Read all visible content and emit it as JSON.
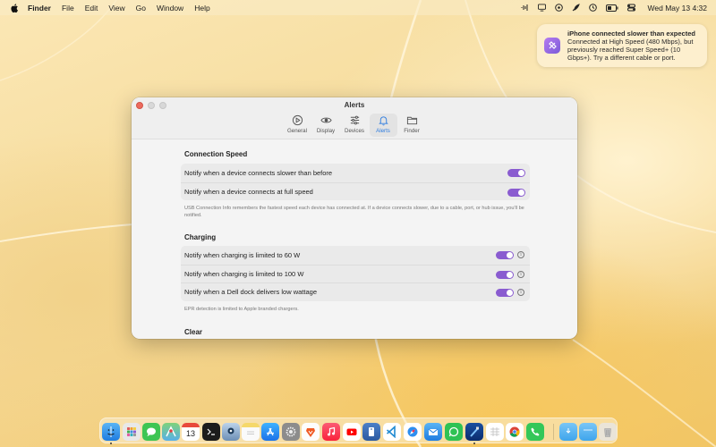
{
  "menubar": {
    "app_name": "Finder",
    "menus": [
      "File",
      "Edit",
      "View",
      "Go",
      "Window",
      "Help"
    ],
    "clock": "Wed May 13  4:32",
    "status_icons": [
      "waveform-icon",
      "display-icon",
      "link-icon",
      "feather-icon",
      "time-machine-icon",
      "battery-icon",
      "control-center-icon"
    ]
  },
  "notification": {
    "title": "iPhone connected slower than expected",
    "body": "Connected at High Speed (480 Mbps), but previously reached Super Speed+ (10 Gbps+). Try a different cable or port."
  },
  "window": {
    "title": "Alerts",
    "tabs": [
      {
        "label": "General",
        "icon": "play-circle-icon"
      },
      {
        "label": "Display",
        "icon": "eye-icon"
      },
      {
        "label": "Devices",
        "icon": "sliders-icon"
      },
      {
        "label": "Alerts",
        "icon": "bell-icon"
      },
      {
        "label": "Finder",
        "icon": "folder-icon"
      }
    ],
    "active_tab": "Alerts",
    "accent_color": "#2f7de0",
    "toggle_color": "#8a5cd0",
    "sections": {
      "connection_speed": {
        "title": "Connection Speed",
        "rows": [
          {
            "label": "Notify when a device connects slower than before",
            "enabled": true
          },
          {
            "label": "Notify when a device connects at full speed",
            "enabled": true
          }
        ],
        "note": "USB Connection Info remembers the fastest speed each device has connected at. If a device connects slower, due to a cable, port, or hub issue, you'll be notified."
      },
      "charging": {
        "title": "Charging",
        "rows": [
          {
            "label": "Notify when charging is limited to 60 W",
            "enabled": true
          },
          {
            "label": "Notify when charging is limited to 100 W",
            "enabled": true
          },
          {
            "label": "Notify when a Dell dock delivers low wattage",
            "enabled": true
          }
        ],
        "note": "EPR detection is limited to Apple branded chargers."
      },
      "clear": {
        "title": "Clear"
      }
    }
  },
  "dock": {
    "calendar_day": "13",
    "apps": [
      "finder-icon",
      "launchpad-icon",
      "messages-icon",
      "maps-icon",
      "calendar-icon",
      "terminal-icon",
      "preview-icon",
      "notes-icon",
      "app-store-icon",
      "system-settings-icon",
      "brave-icon",
      "music-icon",
      "youtube-icon",
      "book-icon",
      "vscode-icon",
      "safari-icon",
      "mail-icon",
      "whatsapp-icon",
      "xcode-icon",
      "numbers-icon",
      "chrome-icon",
      "phone-icon",
      "folder-icon",
      "downloads-icon",
      "trash-icon"
    ]
  }
}
